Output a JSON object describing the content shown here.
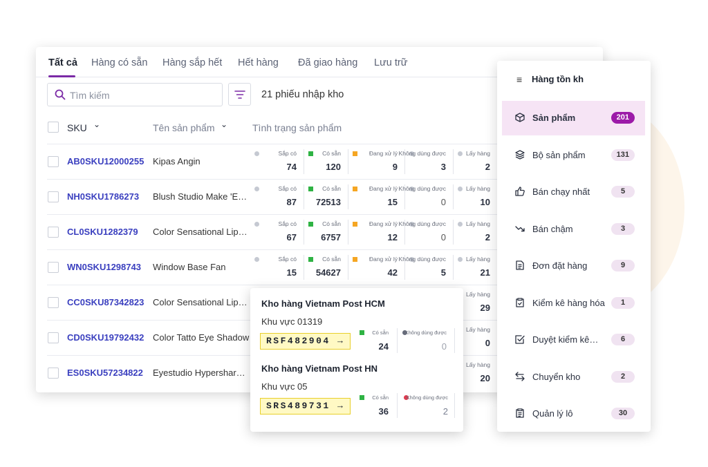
{
  "tabs": [
    "Tất cả",
    "Hàng có sẵn",
    "Hàng sắp hết",
    "Hết hàng",
    "Đã giao hàng",
    "Lưu trữ"
  ],
  "search": {
    "placeholder": "Tìm kiếm"
  },
  "receipt_count": "21 phiếu nhập kho",
  "columns": {
    "sku": "SKU",
    "name": "Tên sản phẩm",
    "status": "Tình trạng sản phẩm"
  },
  "stat_labels": {
    "coming": "Sắp có",
    "available": "Có sẵn",
    "processing": "Đang xử lý",
    "unusable": "Không dùng được",
    "picking": "Lấy hàng"
  },
  "colors": {
    "accent": "#7b2aa6",
    "sku_link": "#3a3fbf",
    "coming": "#c5c9d2",
    "available": "#2fb344",
    "processing": "#f5a623",
    "unusable_dot": "#c5c9d2",
    "unusable_red": "#e03a4e",
    "unusable_gray": "#666b7a",
    "picking": "#c5c9d2"
  },
  "rows": [
    {
      "sku": "AB0SKU12000255",
      "name": "Kipas Angin",
      "coming": "74",
      "available": "120",
      "processing": "9",
      "unusable": "3",
      "picking": "2"
    },
    {
      "sku": "NH0SKU1786273",
      "name": "Blush Studio Make 'Em Blush",
      "coming": "87",
      "available": "72513",
      "processing": "15",
      "unusable": "0",
      "picking": "10"
    },
    {
      "sku": "CL0SKU1282379",
      "name": "Color Sensational Lip Balm",
      "coming": "67",
      "available": "6757",
      "processing": "12",
      "unusable": "0",
      "picking": "2"
    },
    {
      "sku": "WN0SKU1298743",
      "name": "Window Base Fan",
      "coming": "15",
      "available": "54627",
      "processing": "42",
      "unusable": "5",
      "picking": "21"
    },
    {
      "sku": "CC0SKU87342823",
      "name": "Color Sensational Lip Cream",
      "picking": "29"
    },
    {
      "sku": "CD0SKU19792432",
      "name": "Color Tatto Eye Shadow",
      "picking": "0"
    },
    {
      "sku": "ES0SKU57234822",
      "name": "Eyestudio Hypersharp Liner",
      "picking": "20"
    }
  ],
  "popup": {
    "warehouses": [
      {
        "name": "Kho hàng Vietnam Post HCM",
        "zone": "Khu vực 01319",
        "code": "RSF482904 →",
        "available": "24",
        "unusable": "0"
      },
      {
        "name": "Kho hàng Vietnam Post HN",
        "zone": "Khu vực 05",
        "code": "SRS489731 →",
        "available": "36",
        "unusable": "2"
      }
    ]
  },
  "sidebar": {
    "title": "Hàng tồn kh",
    "items": [
      {
        "icon": "box-icon",
        "label": "Sản phẩm",
        "count": "201"
      },
      {
        "icon": "layers-icon",
        "label": "Bộ sản phẩm",
        "count": "131"
      },
      {
        "icon": "thumbs-up-icon",
        "label": "Bán chạy nhất",
        "count": "5"
      },
      {
        "icon": "trend-down-icon",
        "label": "Bán chậm",
        "count": "3"
      },
      {
        "icon": "document-icon",
        "label": "Đơn đặt hàng",
        "count": "9"
      },
      {
        "icon": "clipboard-check-icon",
        "label": "Kiểm kê hàng hóa",
        "count": "1"
      },
      {
        "icon": "check-square-icon",
        "label": "Duyệt kiểm kê…",
        "count": "6"
      },
      {
        "icon": "transfer-icon",
        "label": "Chuyển kho",
        "count": "2"
      },
      {
        "icon": "clipboard-list-icon",
        "label": "Quản lý lô",
        "count": "30"
      }
    ]
  }
}
